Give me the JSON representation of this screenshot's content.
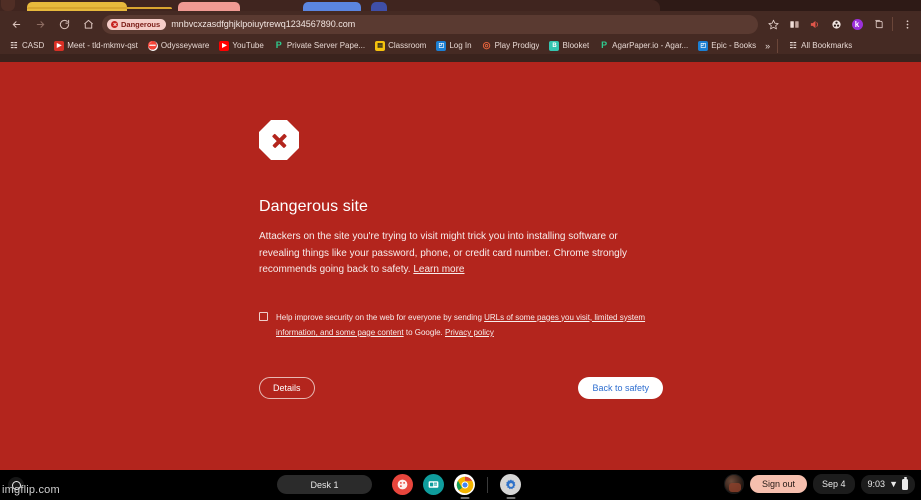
{
  "browser": {
    "nav": {
      "back_label": "Back",
      "forward_label": "Forward",
      "reload_label": "Reload",
      "home_label": "Home"
    },
    "omnibox": {
      "security_chip": "Dangerous",
      "url": "mnbvcxzasdfghjklpoiuytrewq1234567890.com"
    },
    "toolbar_right": [
      {
        "name": "bookmark-star-icon",
        "glyph": "☆"
      },
      {
        "name": "split-view-icon",
        "glyph": "▮▮"
      },
      {
        "name": "media-cast-icon",
        "glyph": "🔊"
      },
      {
        "name": "extensions-puzzle-icon",
        "glyph": "⚙"
      },
      {
        "name": "kick-extension-icon",
        "glyph": "k"
      },
      {
        "name": "share-icon",
        "glyph": "❐"
      },
      {
        "name": "chrome-menu-icon",
        "glyph": "⋮"
      }
    ],
    "tabs_partial": [
      {
        "name": "tab-stub-1",
        "color": "#e8b93c"
      },
      {
        "name": "tab-stub-2",
        "color": "#f09a93"
      },
      {
        "name": "tab-stub-3",
        "color": "#5b86e0"
      },
      {
        "name": "tab-stub-4",
        "color": "#3f4fa8"
      }
    ],
    "bookmarks": [
      {
        "label": "CASD",
        "icon": "folder-icon",
        "glyph": "❐",
        "color": "transparent",
        "text_color": "#e7d8d3"
      },
      {
        "label": "Meet - tld-mkmv-qst",
        "icon": "google-meet-icon",
        "glyph": "▶",
        "color": "#d93025",
        "text_color": "#fff"
      },
      {
        "label": "Odysseyware",
        "icon": "odysseyware-icon",
        "glyph": "⛔",
        "color": "#ffffff",
        "text_color": "#d93025"
      },
      {
        "label": "YouTube",
        "icon": "youtube-icon",
        "glyph": "▶",
        "color": "#ff0000",
        "text_color": "#fff"
      },
      {
        "label": "Private Server Pape...",
        "icon": "prodigy-p-icon",
        "glyph": "P",
        "color": "transparent",
        "text_color": "#2ecc8f"
      },
      {
        "label": "Classroom",
        "icon": "google-classroom-icon",
        "glyph": "▤",
        "color": "#f4c20d",
        "text_color": "#1a1a1a"
      },
      {
        "label": "Log In",
        "icon": "clever-icon",
        "glyph": "◰",
        "color": "#1b7fd3",
        "text_color": "#fff"
      },
      {
        "label": "Play Prodigy",
        "icon": "prodigy-icon",
        "glyph": "◎",
        "color": "transparent",
        "text_color": "#e8643c"
      },
      {
        "label": "Blooket",
        "icon": "blooket-icon",
        "glyph": "B",
        "color": "#35c6b0",
        "text_color": "#fff"
      },
      {
        "label": "AgarPaper.io - Agar...",
        "icon": "agarpaper-icon",
        "glyph": "P",
        "color": "transparent",
        "text_color": "#2ecc8f"
      },
      {
        "label": "Epic - Books",
        "icon": "epic-books-icon",
        "glyph": "◰",
        "color": "#1b7fd3",
        "text_color": "#fff"
      }
    ],
    "bookmarks_overflow": "»",
    "all_bookmarks": {
      "label": "All Bookmarks",
      "icon": "folder-icon",
      "glyph": "❐"
    }
  },
  "interstitial": {
    "icon_name": "octagon-x-error-icon",
    "title": "Dangerous site",
    "body_before_link": "Attackers on the site you're trying to visit might trick you into installing software or revealing things like your password, phone, or credit card number. Chrome strongly recommends going back to safety. ",
    "learn_more": "Learn more",
    "optin": {
      "checked": false,
      "text_1": "Help improve security on the web for everyone by sending ",
      "link_1": "URLs of some pages you visit, limited system information, and some page content",
      "text_2": " to Google. ",
      "link_2": "Privacy policy"
    },
    "details_button": "Details",
    "safety_button": "Back to safety",
    "background_color": "#b3251d"
  },
  "shelf": {
    "launcher_name": "chromeos-launcher-button",
    "desk_label": "Desk 1",
    "apps": [
      {
        "name": "shelf-app-paint",
        "glyph": "🎨",
        "color": "#e8453c",
        "running": false
      },
      {
        "name": "shelf-app-gallery",
        "glyph": "📰",
        "color": "#0f9d9d",
        "running": false
      },
      {
        "name": "shelf-app-chrome",
        "glyph": "◉",
        "color": "#ffffff",
        "running": true
      },
      {
        "name": "shelf-app-settings",
        "glyph": "⚙",
        "color": "#d6d6d6",
        "running": true
      }
    ],
    "sign_out": "Sign out",
    "date": "Sep 4",
    "time": "9:03",
    "wifi_glyph": "▼",
    "avatar_name": "user-avatar"
  },
  "watermark": "imgflip.com"
}
